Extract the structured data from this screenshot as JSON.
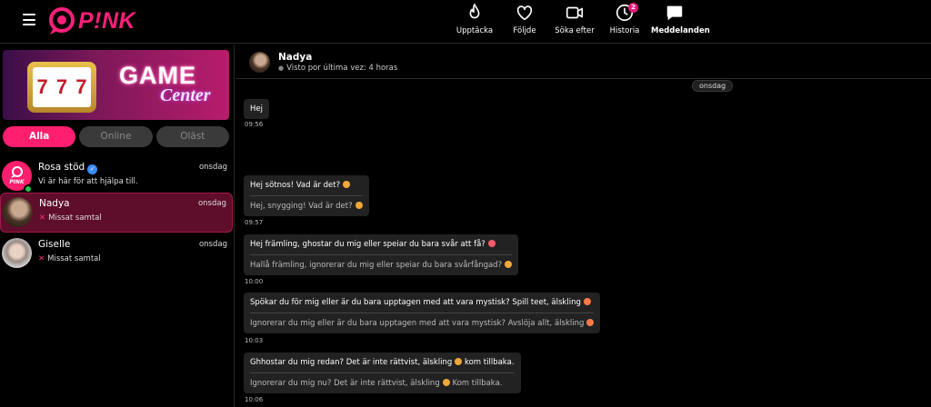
{
  "app": {
    "brand": "P!NK",
    "brand_color": "#ff1f7a"
  },
  "nav": [
    {
      "icon": "flame-icon",
      "label": "Upptäcka"
    },
    {
      "icon": "heart-icon",
      "label": "Följde"
    },
    {
      "icon": "video-icon",
      "label": "Söka efter"
    },
    {
      "icon": "clock-icon",
      "label": "Historia",
      "badge": "2"
    },
    {
      "icon": "chat-icon",
      "label": "Meddelanden",
      "active": true
    }
  ],
  "banner": {
    "title": "GAME",
    "subtitle": "Center",
    "slot": [
      "7",
      "7",
      "7"
    ]
  },
  "filters": [
    "Alla",
    "Online",
    "Oläst"
  ],
  "conversations": [
    {
      "name": "Rosa stöd",
      "date": "onsdag",
      "preview": "Vi är här för att hjälpa till.",
      "avatar_text": "PINK"
    },
    {
      "name": "Nadya",
      "date": "onsdag",
      "preview": "Missat samtal",
      "preview_icon": "x-icon"
    },
    {
      "name": "Giselle",
      "date": "onsdag",
      "preview": "Missat samtal",
      "preview_icon": "x-icon"
    }
  ],
  "chat": {
    "name": "Nadya",
    "status": "Visto por última vez: 4 horas",
    "day_label": "onsdag",
    "messages": [
      {
        "text": "Hej",
        "time": "09:56"
      },
      {
        "text": "Hej sötnos! Vad är det?",
        "translation": "Hej, snygging! Vad är det?",
        "time": "09:57"
      },
      {
        "text": "Hej främling, ghostar du mig eller speiar du bara svår att få?",
        "translation": "Hallå främling, ignorerar du mig eller speiar du bara svårfångad?",
        "time": "10:00"
      },
      {
        "text": "Spökar du för mig eller är du bara upptagen med att vara mystisk? Spill teet, älskling",
        "translation": "Ignorerar du mig eller är du bara upptagen med att vara mystisk? Avslöja allt, älskling",
        "time": "10:03"
      },
      {
        "text": "Ghhostar du mig redan? Det är inte rättvist, älskling",
        "text_end": "kom tillbaka.",
        "translation": "Ignorerar du mig nu? Det är inte rättvist, älskling",
        "translation_end": "Kom tillbaka.",
        "time": "10:06"
      }
    ]
  }
}
